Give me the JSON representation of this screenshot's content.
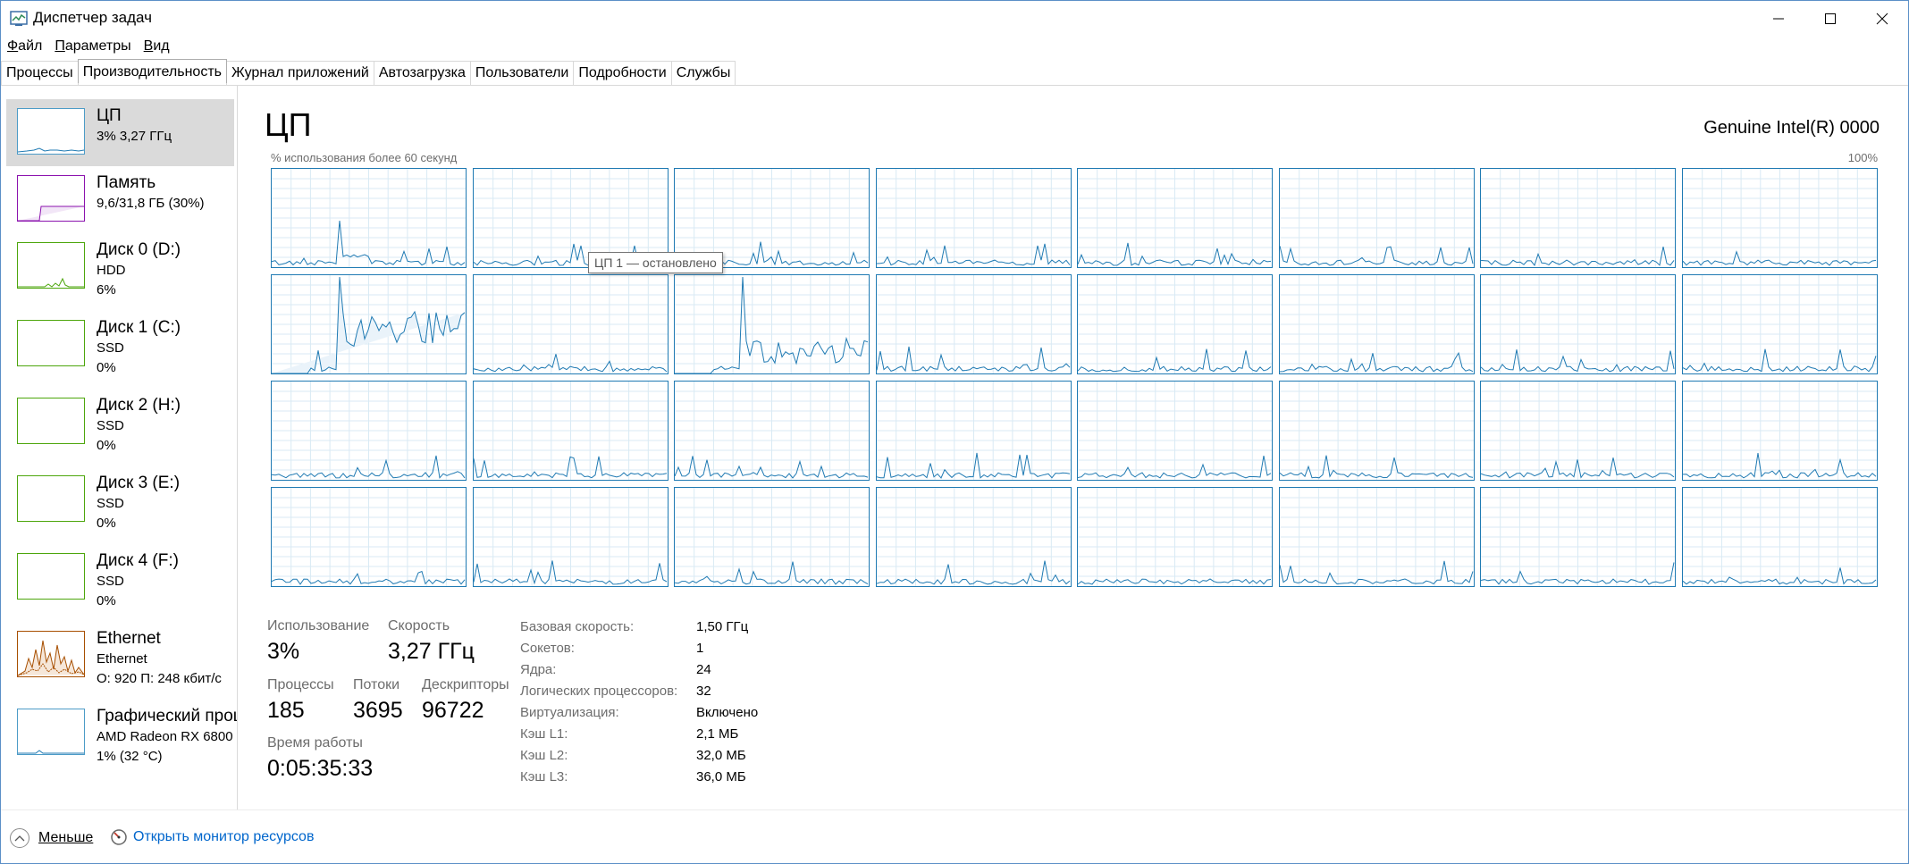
{
  "window": {
    "title": "Диспетчер задач"
  },
  "menu": {
    "file_u": "Ф",
    "file_rest": "айл",
    "params_u": "П",
    "params_rest": "араметры",
    "view_u": "В",
    "view_rest": "ид"
  },
  "tabs": [
    "Процессы",
    "Производительность",
    "Журнал приложений",
    "Автозагрузка",
    "Пользователи",
    "Подробности",
    "Службы"
  ],
  "sidebar": {
    "items": [
      {
        "title": "ЦП",
        "sub1": "3%  3,27 ГГц",
        "sub2": ""
      },
      {
        "title": "Память",
        "sub1": "9,6/31,8 ГБ (30%)",
        "sub2": ""
      },
      {
        "title": "Диск 0 (D:)",
        "sub1": "HDD",
        "sub2": "6%"
      },
      {
        "title": "Диск 1 (C:)",
        "sub1": "SSD",
        "sub2": "0%"
      },
      {
        "title": "Диск 2 (H:)",
        "sub1": "SSD",
        "sub2": "0%"
      },
      {
        "title": "Диск 3 (E:)",
        "sub1": "SSD",
        "sub2": "0%"
      },
      {
        "title": "Диск 4 (F:)",
        "sub1": "SSD",
        "sub2": "0%"
      },
      {
        "title": "Ethernet",
        "sub1": "Ethernet",
        "sub2": "О: 920  П: 248 кбит/с"
      },
      {
        "title": "Графический процессор",
        "sub1": "AMD Radeon RX 6800",
        "sub2": "1%  (32 °C)"
      }
    ]
  },
  "main": {
    "title": "ЦП",
    "cpu_name": "Genuine Intel(R) 0000",
    "graph_label": "% использования более 60 секунд",
    "graph_max": "100%",
    "tooltip": "ЦП 1 — остановлено"
  },
  "stats": {
    "usage_label": "Использование",
    "usage_value": "3%",
    "speed_label": "Скорость",
    "speed_value": "3,27 ГГц",
    "processes_label": "Процессы",
    "processes_value": "185",
    "threads_label": "Потоки",
    "threads_value": "3695",
    "handles_label": "Дескрипторы",
    "handles_value": "96722",
    "uptime_label": "Время работы",
    "uptime_value": "0:05:35:33"
  },
  "info": [
    {
      "label": "Базовая скорость:",
      "value": "1,50 ГГц"
    },
    {
      "label": "Сокетов:",
      "value": "1"
    },
    {
      "label": "Ядра:",
      "value": "24"
    },
    {
      "label": "Логических процессоров:",
      "value": "32"
    },
    {
      "label": "Виртуализация:",
      "value": "Включено"
    },
    {
      "label": "Кэш L1:",
      "value": "2,1 МБ"
    },
    {
      "label": "Кэш L2:",
      "value": "32,0 МБ"
    },
    {
      "label": "Кэш L3:",
      "value": "36,0 МБ"
    }
  ],
  "footer": {
    "less": "Меньше",
    "monitor": "Открыть монитор ресурсов"
  },
  "colors": {
    "cpu": "#1f7ab3",
    "memory": "#8b12ae",
    "disk": "#4da60c",
    "ethernet": "#a74f01"
  }
}
